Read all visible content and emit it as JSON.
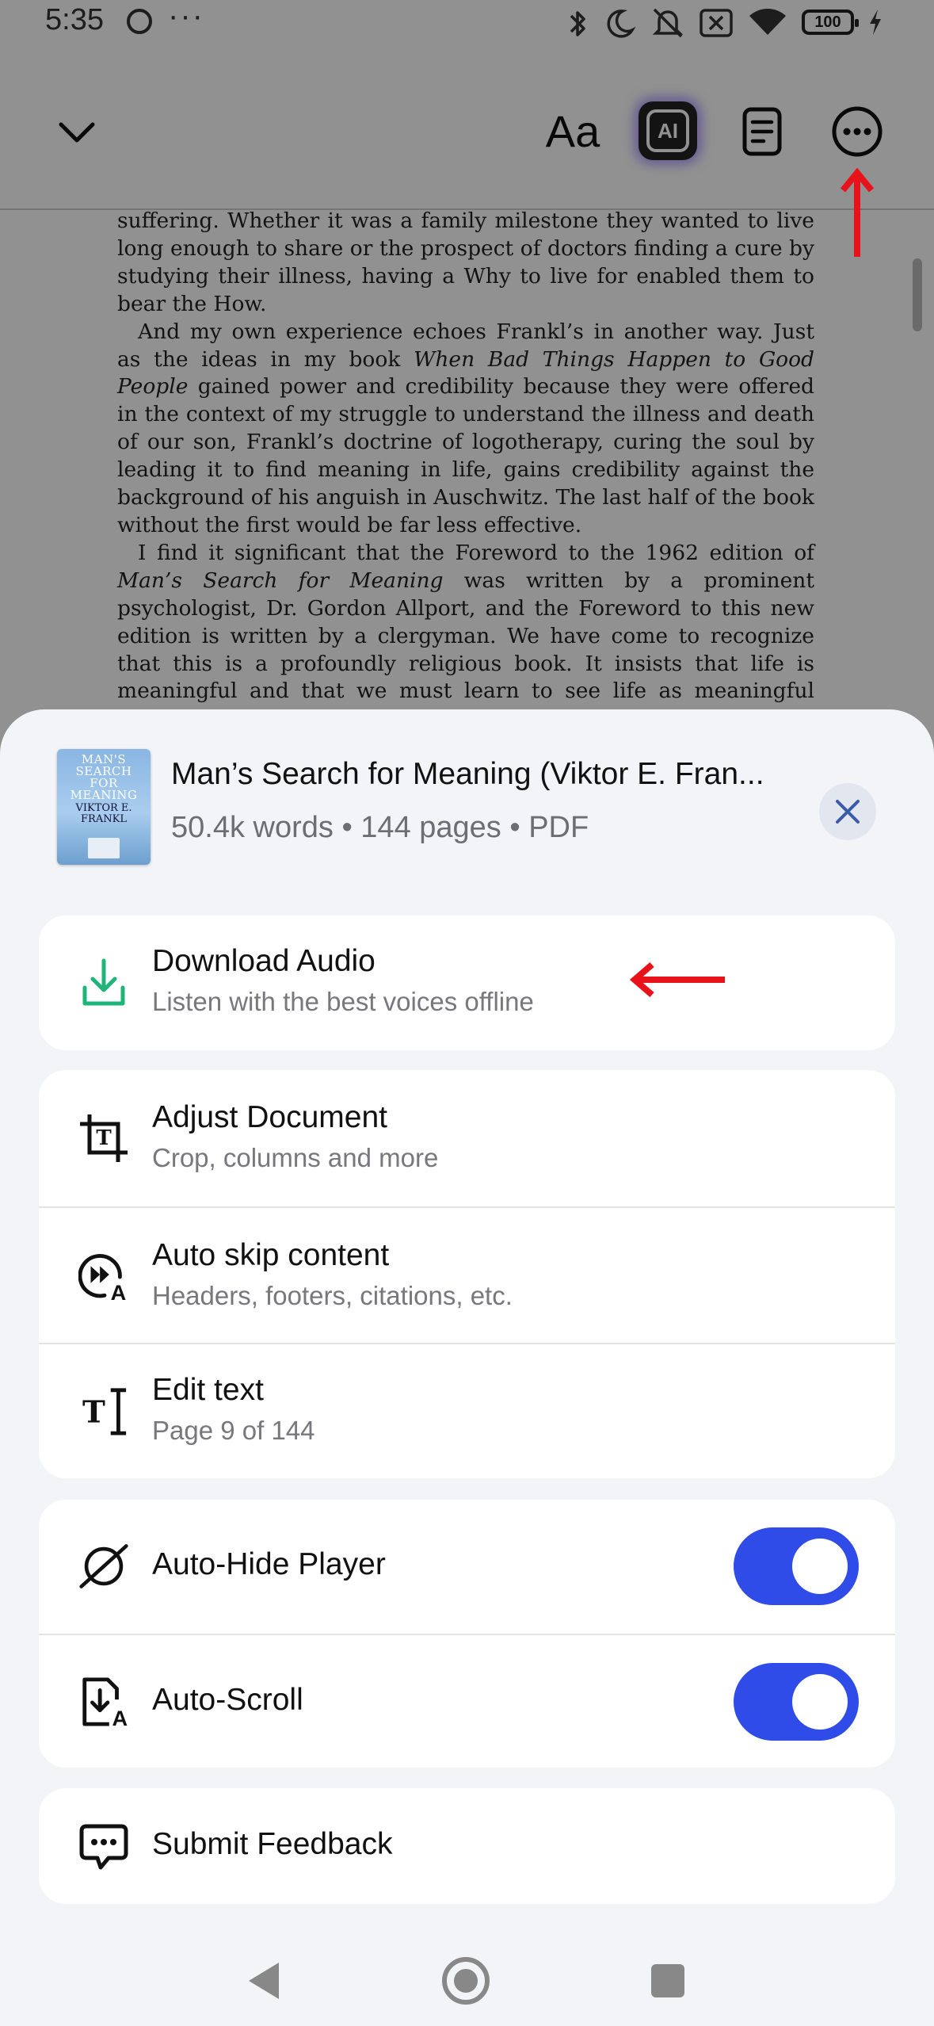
{
  "status_bar": {
    "time": "5:35",
    "battery": "100"
  },
  "toolbar": {
    "font_button_label": "Aa",
    "ai_button_label": "AI"
  },
  "page_text": {
    "p1": "suffering. Whether it was a family milestone they wanted to live long enough to share or the prospect of doctors finding a cure by studying their illness, having a Why to live for enabled them to bear the How.",
    "p2_a": "And my own experience echoes Frankl’s in another way. Just as the ideas in my book ",
    "p2_title": "When Bad Things Happen to Good People",
    "p2_b": " gained power and credibility because they were offered in the context of my struggle to understand the illness and death of our son, Frankl’s doctrine of logotherapy, curing the soul by leading it to find meaning in life, gains credibility against the background of his anguish in Auschwitz. The last half of the book without the first would be far less effective.",
    "p3_a": "I find it significant that the Foreword to the 1962 edition of ",
    "p3_title": "Man’s Search for Meaning",
    "p3_b": " was written by a prominent psychologist, Dr. Gordon Allport, and the Foreword to this new edition is written by a clergyman. We have come to recognize that this is a profoundly religious book. It insists that life is meaningful and that we must learn to see life as meaningful despite our circumstances."
  },
  "document": {
    "title": "Man’s Search for Meaning (Viktor E. Fran...",
    "meta": "50.4k words • 144 pages • PDF",
    "cover": {
      "title_line1": "MAN'S",
      "title_line2": "SEARCH",
      "title_line3": "FOR",
      "title_line4": "MEANING",
      "author_line1": "VIKTOR E.",
      "author_line2": "FRANKL"
    }
  },
  "menu": {
    "download": {
      "title": "Download Audio",
      "subtitle": "Listen with the best voices offline"
    },
    "adjust": {
      "title": "Adjust Document",
      "subtitle": "Crop, columns and more"
    },
    "auto_skip": {
      "title": "Auto skip content",
      "subtitle": "Headers, footers, citations, etc."
    },
    "edit_text": {
      "title": "Edit text",
      "subtitle": "Page 9 of 144"
    },
    "auto_hide": {
      "title": "Auto-Hide Player",
      "enabled": true
    },
    "auto_scroll": {
      "title": "Auto-Scroll",
      "enabled": true
    },
    "feedback": {
      "title": "Submit Feedback"
    }
  },
  "colors": {
    "accent": "#2f4be8",
    "download_icon": "#1fb57a",
    "annotation_arrow": "#e8121a",
    "sheet_background": "#f3f4f8"
  },
  "icons": {
    "back": "chevron-down-icon",
    "outline": "document-outline-icon",
    "more": "more-horizontal-icon",
    "download": "download-icon",
    "crop": "crop-icon",
    "auto_skip": "fast-forward-a-icon",
    "edit_text": "text-cursor-icon",
    "auto_hide": "eye-off-icon",
    "auto_scroll": "document-scroll-icon",
    "feedback": "chat-bubble-icon"
  }
}
